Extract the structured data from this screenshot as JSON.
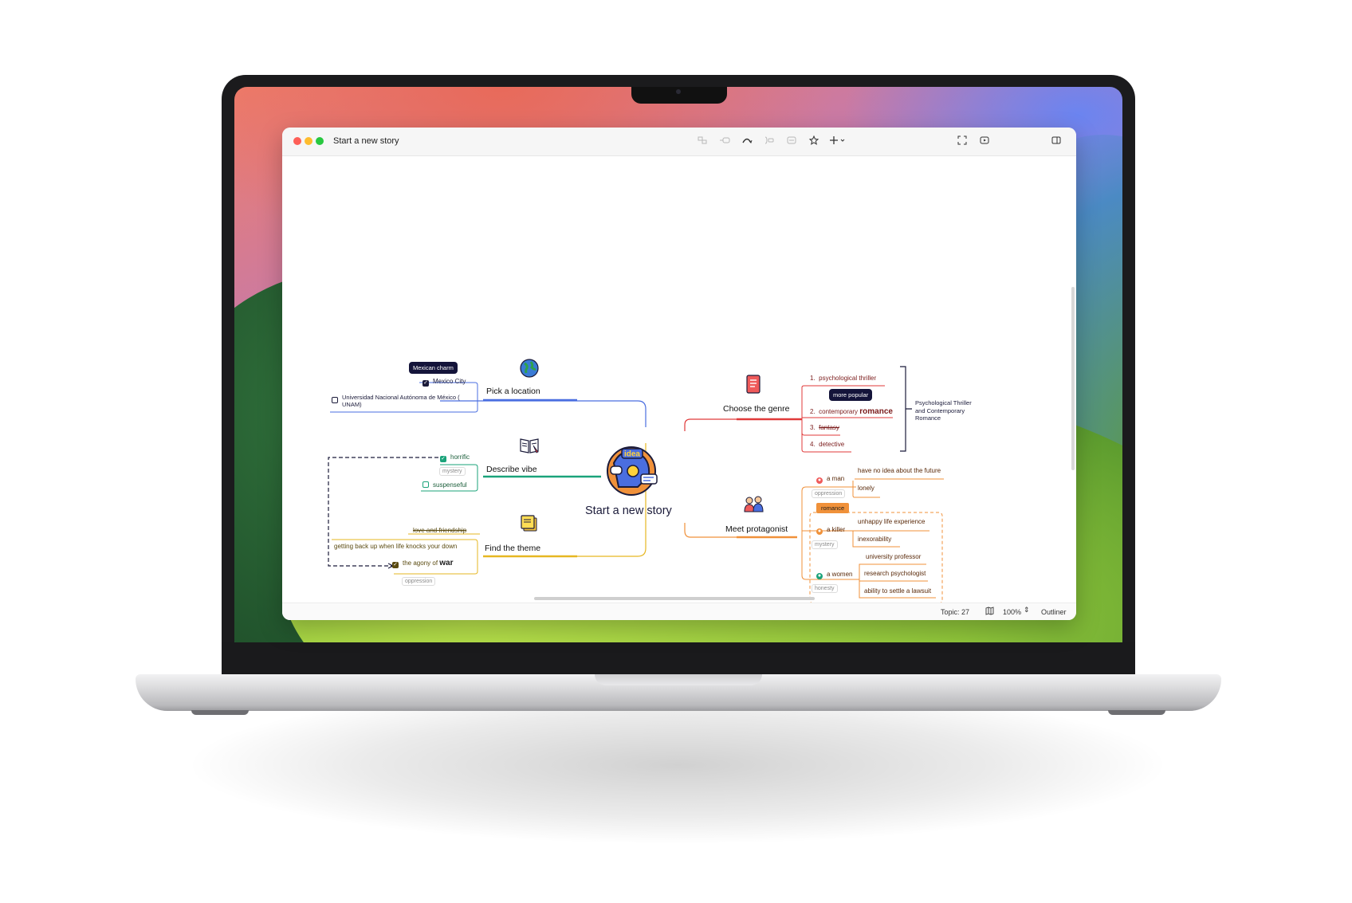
{
  "window": {
    "title": "Start a new story",
    "toolbar": {
      "subtopic_icon": "subtopic-icon",
      "topic_icon": "topic-icon",
      "relationship_icon": "relationship-icon",
      "boundary_icon": "boundary-icon",
      "summary_icon": "summary-icon",
      "marker_icon": "star-icon",
      "insert_icon": "plus-icon",
      "fullscreen_icon": "fullscreen-icon",
      "pitch_icon": "presentation-icon",
      "panel_icon": "sidebar-panel-icon"
    }
  },
  "statusbar": {
    "topic_count": "Topic: 27",
    "zoom": "100%",
    "outliner": "Outliner"
  },
  "map": {
    "central": "Start a new story",
    "central_badge": "idea",
    "location": {
      "title": "Pick a location",
      "tip": "Mexican charm",
      "city": "Mexico City",
      "university": "Universidad Nacional Autónoma de México ( UNAM)"
    },
    "vibe": {
      "title": "Describe vibe",
      "horrific": "horrific",
      "mystery": "mystery",
      "suspenseful": "suspenseful"
    },
    "theme": {
      "title": "Find the theme",
      "love": "love and friendship",
      "getting_back": "getting back up when life knocks your down",
      "agony_prefix": "the agony of",
      "agony_word": "war",
      "oppression": "oppression"
    },
    "genre": {
      "title": "Choose the genre",
      "items": [
        {
          "num": "1.",
          "text": "psychological thriller"
        },
        {
          "num": "2.",
          "text": "contemporary",
          "bold": "romance"
        },
        {
          "num": "3.",
          "text": "fantasy"
        },
        {
          "num": "4.",
          "text": "detective"
        }
      ],
      "tip": "more popular",
      "summary": "Psychological Thriller and Contemporary Romance"
    },
    "protagonist": {
      "title": "Meet protagonist",
      "man": "a man",
      "man_items": [
        "have no idea about the future",
        "lonely"
      ],
      "man_tag": "oppression",
      "romance_label": "romance",
      "killer": "a killer",
      "killer_items": [
        "unhappy life experience",
        "inexorability"
      ],
      "killer_tag": "mystery",
      "women": "a women",
      "women_items": [
        "university professor",
        "research psychologist",
        "ability to settle a lawsuit"
      ],
      "women_tag": "honesty"
    }
  },
  "colors": {
    "location": "#4a6ee0",
    "vibe": "#1aa37a",
    "theme": "#e6b722",
    "genre": "#e03a3a",
    "protagonist": "#f0913a",
    "central_dark": "#1b1b3a"
  }
}
